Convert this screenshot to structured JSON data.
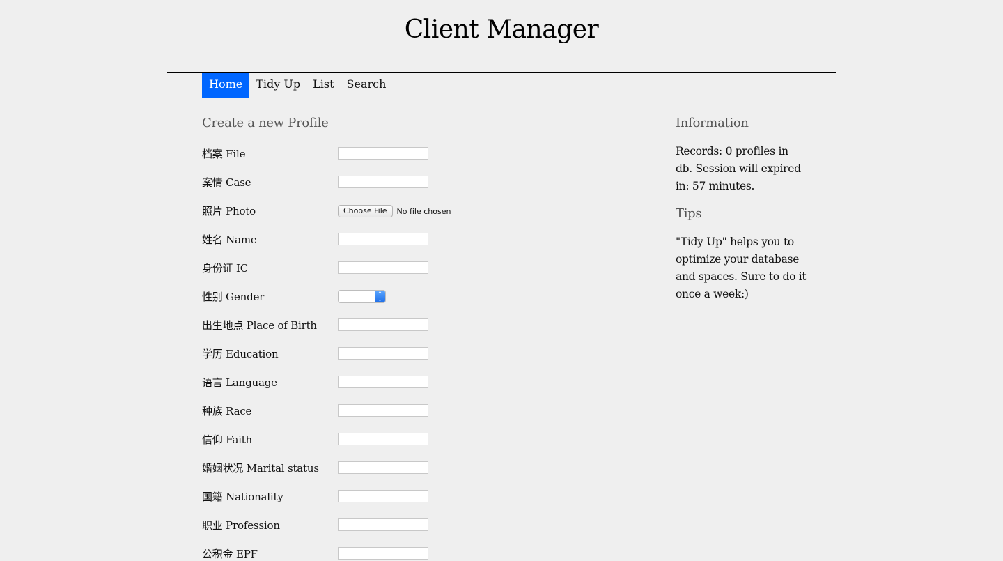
{
  "site": {
    "title": "Client Manager"
  },
  "nav": {
    "items": [
      {
        "label": "Home"
      },
      {
        "label": "Tidy Up"
      },
      {
        "label": "List"
      },
      {
        "label": "Search"
      }
    ]
  },
  "form": {
    "title": "Create a new Profile",
    "fields": [
      {
        "label": "档案 File",
        "value": ""
      },
      {
        "label": "案情 Case",
        "value": ""
      },
      {
        "label": "照片 Photo",
        "button": "Choose File",
        "status": "No file chosen"
      },
      {
        "label": "姓名 Name",
        "value": ""
      },
      {
        "label": "身份证 IC",
        "value": ""
      },
      {
        "label": "性别 Gender",
        "value": ""
      },
      {
        "label": "出生地点 Place of Birth",
        "value": ""
      },
      {
        "label": "学历 Education",
        "value": ""
      },
      {
        "label": "语言 Language",
        "value": ""
      },
      {
        "label": "种族 Race",
        "value": ""
      },
      {
        "label": "信仰 Faith",
        "value": ""
      },
      {
        "label": "婚姻状况 Marital status",
        "value": ""
      },
      {
        "label": "国籍 Nationality",
        "value": ""
      },
      {
        "label": "职业 Profession",
        "value": ""
      },
      {
        "label": "公积金 EPF",
        "value": ""
      }
    ]
  },
  "sidebar": {
    "info_title": "Information",
    "info_text": "Records: 0 profiles in db. Session will expired in: 57 minutes.",
    "tips_title": "Tips",
    "tips_text": "\"Tidy Up\" helps you to optimize your database and spaces. Sure to do it once a week:)"
  },
  "colors": {
    "accent": "#0066ff",
    "background": "#efefef"
  }
}
